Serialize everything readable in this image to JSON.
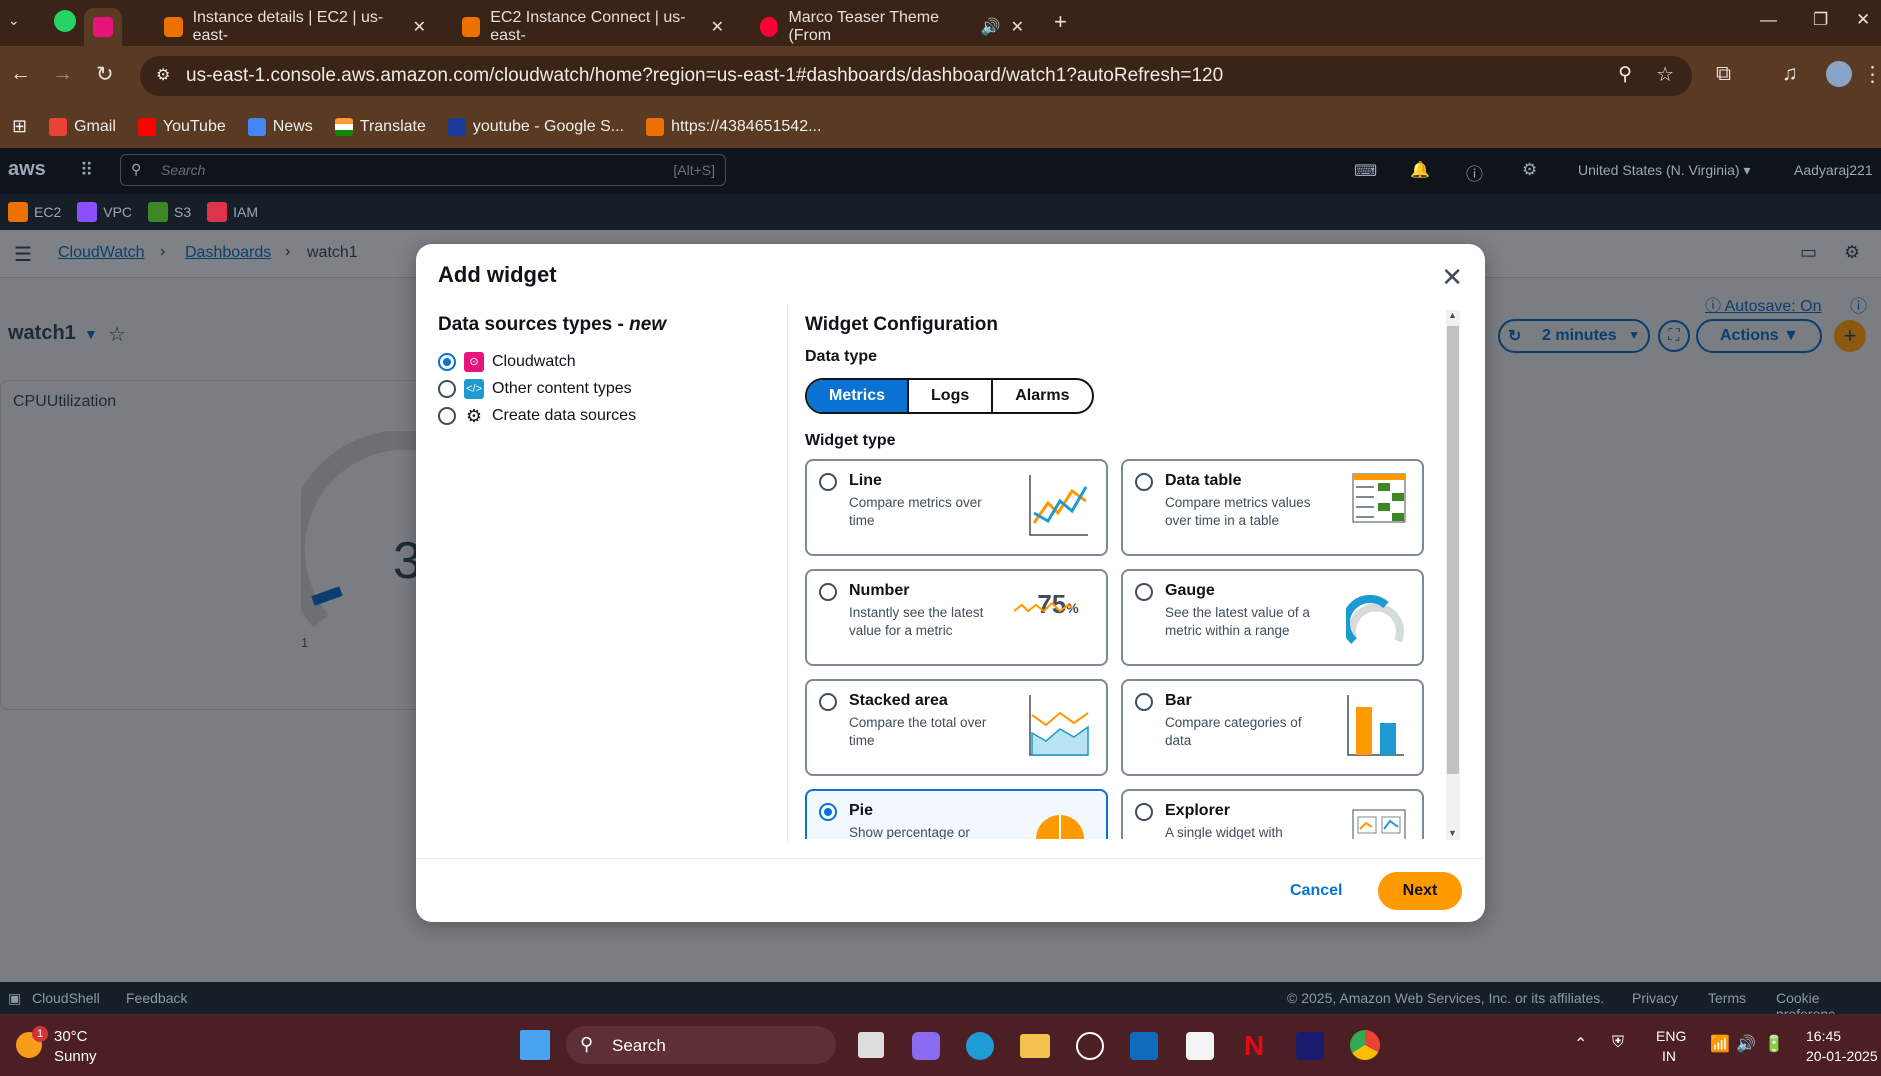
{
  "browser": {
    "tabs": [
      {
        "title": "Instance details | EC2 | us-east-"
      },
      {
        "title": "EC2 Instance Connect | us-east-"
      },
      {
        "title": "Marco Teaser Theme (From"
      }
    ],
    "url": "us-east-1.console.aws.amazon.com/cloudwatch/home?region=us-east-1#dashboards/dashboard/watch1?autoRefresh=120",
    "bookmarks": [
      "Gmail",
      "YouTube",
      "News",
      "Translate",
      "youtube - Google S...",
      "https://4384651542..."
    ]
  },
  "aws": {
    "logo": "aws",
    "search_placeholder": "Search",
    "search_shortcut": "[Alt+S]",
    "region": "United States (N. Virginia) ▾",
    "user": "Aadyaraj221",
    "services": [
      "EC2",
      "VPC",
      "S3",
      "IAM"
    ]
  },
  "page": {
    "breadcrumbs": [
      "CloudWatch",
      "Dashboards",
      "watch1"
    ],
    "dashboard_name": "watch1",
    "autosave": "Autosave: On",
    "refresh": "2 minutes",
    "actions": "Actions",
    "widget_title": "CPUUtilization",
    "gauge_partial": "3",
    "gauge_min": "1"
  },
  "modal": {
    "title": "Add widget",
    "sources_title": "Data sources types - ",
    "sources_title_new": "new",
    "sources": [
      {
        "label": "Cloudwatch",
        "selected": true
      },
      {
        "label": "Other content types",
        "selected": false
      },
      {
        "label": "Create data sources",
        "selected": false
      }
    ],
    "config_title": "Widget Configuration",
    "data_type_label": "Data type",
    "data_types": [
      "Metrics",
      "Logs",
      "Alarms"
    ],
    "widget_type_label": "Widget type",
    "widget_types": [
      {
        "name": "Line",
        "desc": "Compare metrics over time"
      },
      {
        "name": "Data table",
        "desc": "Compare metrics values over time in a table"
      },
      {
        "name": "Number",
        "desc": "Instantly see the latest value for a metric"
      },
      {
        "name": "Gauge",
        "desc": "See the latest value of a metric within a range"
      },
      {
        "name": "Stacked area",
        "desc": "Compare the total over time"
      },
      {
        "name": "Bar",
        "desc": "Compare categories of data"
      },
      {
        "name": "Pie",
        "desc": "Show percentage or"
      },
      {
        "name": "Explorer",
        "desc": "A single widget with"
      }
    ],
    "number_preview": "75",
    "number_unit": "%",
    "cancel": "Cancel",
    "next": "Next"
  },
  "footer": {
    "cloudshell": "CloudShell",
    "feedback": "Feedback",
    "copyright": "© 2025, Amazon Web Services, Inc. or its affiliates.",
    "privacy": "Privacy",
    "terms": "Terms",
    "cookie": "Cookie preferenc"
  },
  "taskbar": {
    "temp": "30°C",
    "weather": "Sunny",
    "badge": "1",
    "search": "Search",
    "lang1": "ENG",
    "lang2": "IN",
    "time": "16:45",
    "date": "20-01-2025"
  }
}
